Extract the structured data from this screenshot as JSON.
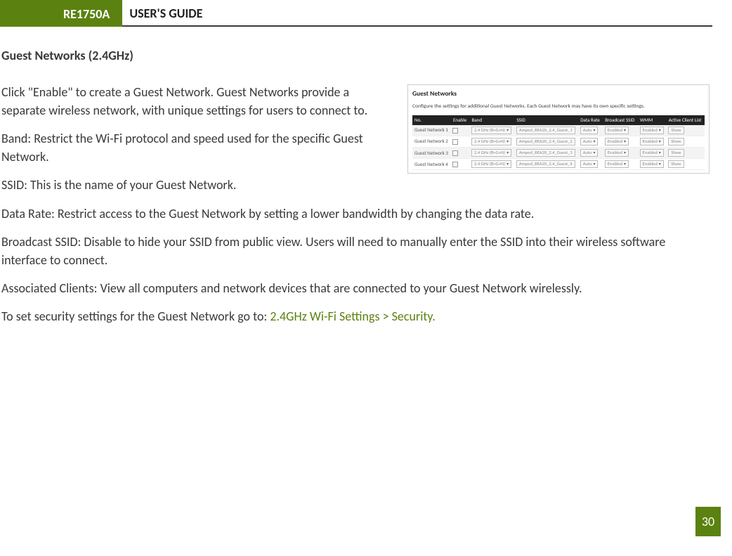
{
  "header": {
    "model": "RE1750A",
    "title": "USER'S GUIDE"
  },
  "section_heading": "Guest Networks (2.4GHz)",
  "paragraphs": {
    "intro": "Click \"Enable\" to create a Guest Network. Guest Networks provide a separate wireless network, with unique settings for users to connect to.",
    "band": "Band: Restrict the Wi-Fi protocol and speed used for the specific Guest Network.",
    "ssid": "SSID: This is the name of your Guest Network.",
    "datarate": "Data Rate: Restrict access to the Guest Network by setting a lower bandwidth by changing the data rate.",
    "broadcast": "Broadcast SSID: Disable to hide your SSID from public view. Users will need to manually enter the SSID into their wireless software interface to connect.",
    "clients": "Associated Clients: View all computers and network devices that are connected to your Guest Network wirelessly.",
    "security_prefix": "To set security settings for the Guest Network go to: ",
    "security_link": "2.4GHz Wi-Fi Settings > Security."
  },
  "screenshot": {
    "title": "Guest Networks",
    "desc": "Configure the settings for additional Guest Networks. Each Guest Network may have its own specific settings.",
    "columns": [
      "No.",
      "Enable",
      "Band",
      "SSID",
      "Data Rate",
      "Broadcast SSID",
      "WMM",
      "Active Client List"
    ],
    "rows": [
      {
        "no": "Guest Network 1",
        "band": "2.4 GHz (B+G+N)",
        "ssid": "Amped_REA20_2.4_Guest_1",
        "rate": "Auto",
        "bcast": "Enabled",
        "wmm": "Enabled",
        "btn": "Show"
      },
      {
        "no": "Guest Network 2",
        "band": "2.4 GHz (B+G+N)",
        "ssid": "Amped_REA20_2.4_Guest_2",
        "rate": "Auto",
        "bcast": "Enabled",
        "wmm": "Enabled",
        "btn": "Show"
      },
      {
        "no": "Guest Network 3",
        "band": "2.4 GHz (B+G+N)",
        "ssid": "Amped_REA20_2.4_Guest_3",
        "rate": "Auto",
        "bcast": "Enabled",
        "wmm": "Enabled",
        "btn": "Show"
      },
      {
        "no": "Guest Network 4",
        "band": "2.4 GHz (B+G+N)",
        "ssid": "Amped_REA20_2.4_Guest_4",
        "rate": "Auto",
        "bcast": "Enabled",
        "wmm": "Enabled",
        "btn": "Show"
      }
    ]
  },
  "page_number": "30"
}
